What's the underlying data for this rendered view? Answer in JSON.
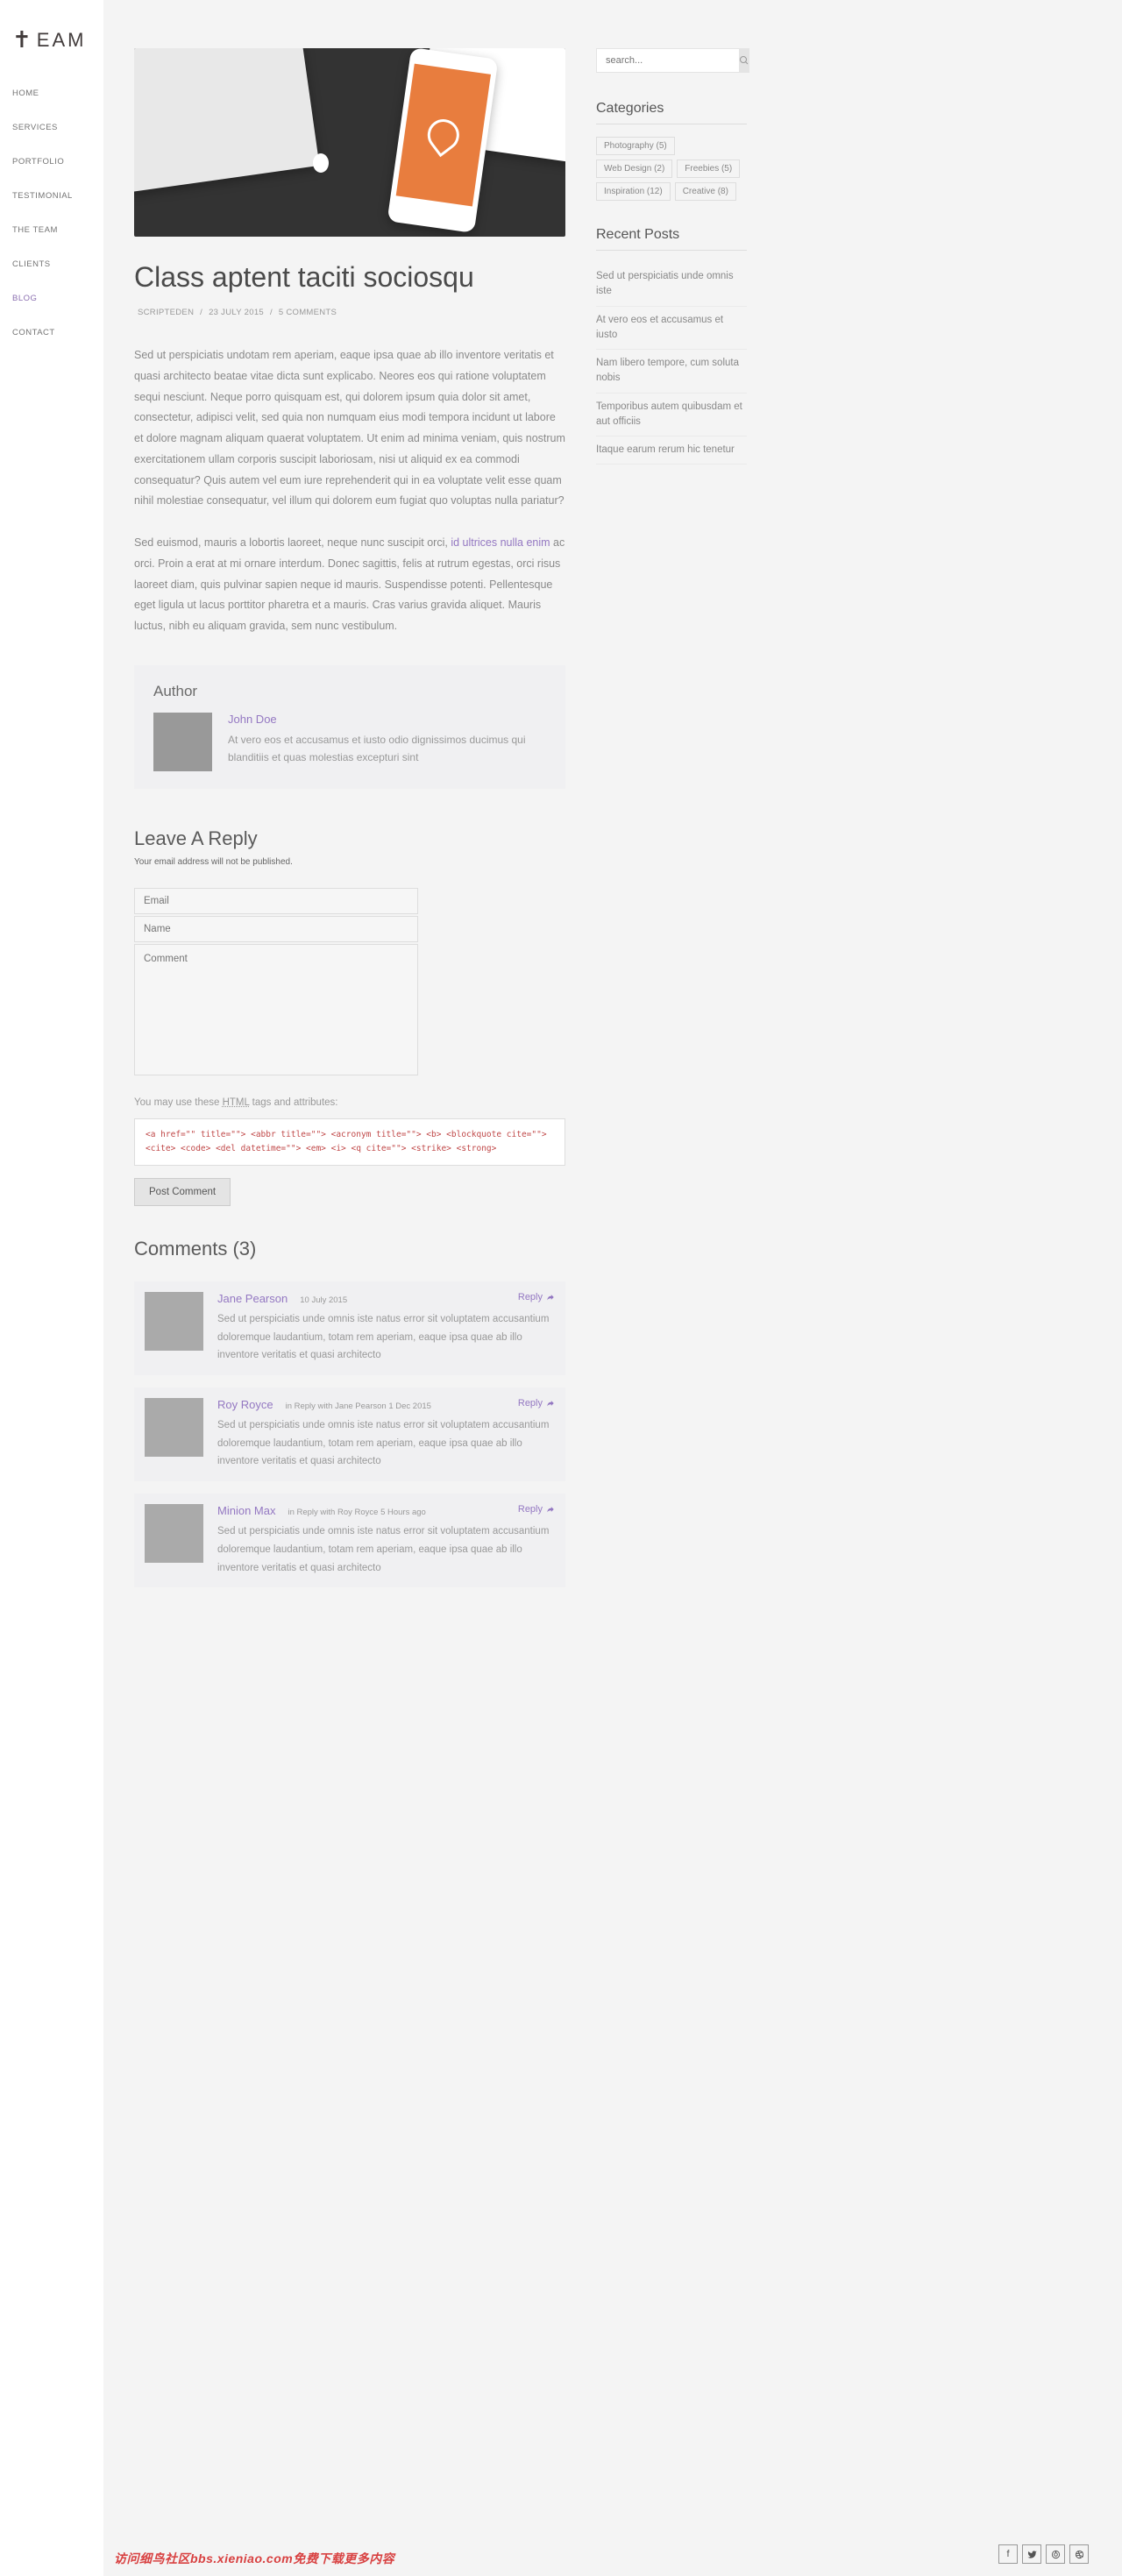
{
  "logo_text": "EAM",
  "nav": [
    "HOME",
    "SERVICES",
    "PORTFOLIO",
    "TESTIMONIAL",
    "THE TEAM",
    "CLIENTS",
    "BLOG",
    "CONTACT"
  ],
  "nav_active": 6,
  "post": {
    "title": "Class aptent taciti sociosqu",
    "meta_author": "SCRIPTEDEN",
    "meta_date": "23 JULY 2015",
    "meta_comments": "5 COMMENTS",
    "p1": "Sed ut perspiciatis undotam rem aperiam, eaque ipsa quae ab illo inventore veritatis et quasi architecto beatae vitae dicta sunt explicabo. Neores eos qui ratione voluptatem sequi nesciunt. Neque porro quisquam est, qui dolorem ipsum quia dolor sit amet, consectetur, adipisci velit, sed quia non numquam eius modi tempora incidunt ut labore et dolore magnam aliquam quaerat voluptatem. Ut enim ad minima veniam, quis nostrum exercitationem ullam corporis suscipit laboriosam, nisi ut aliquid ex ea commodi consequatur? Quis autem vel eum iure reprehenderit qui in ea voluptate velit esse quam nihil molestiae consequatur, vel illum qui dolorem eum fugiat quo voluptas nulla pariatur?",
    "p2a": "Sed euismod, mauris a lobortis laoreet, neque nunc suscipit orci, ",
    "p2_link": "id ultrices nulla enim",
    "p2b": " ac orci. Proin a erat at mi ornare interdum. Donec sagittis, felis at rutrum egestas, orci risus laoreet diam, quis pulvinar sapien neque id mauris. Suspendisse potenti. Pellentesque eget ligula ut lacus porttitor pharetra et a mauris. Cras varius gravida aliquet. Mauris luctus, nibh eu aliquam gravida, sem nunc vestibulum."
  },
  "author": {
    "heading": "Author",
    "name": "John Doe",
    "bio": "At vero eos et accusamus et iusto odio dignissimos ducimus qui blanditiis et quas molestias excepturi sint"
  },
  "reply": {
    "heading": "Leave A Reply",
    "note": "Your email address will not be published.",
    "email_ph": "Email",
    "name_ph": "Name",
    "comment_ph": "Comment",
    "hint_a": "You may use these ",
    "hint_abbr": "HTML",
    "hint_b": " tags and attributes:",
    "code": "<a href=\"\" title=\"\"> <abbr title=\"\"> <acronym title=\"\"> <b> <blockquote cite=\"\"> <cite> <code> <del datetime=\"\"> <em> <i> <q cite=\"\"> <strike> <strong>",
    "submit": "Post Comment"
  },
  "comments": {
    "heading": "Comments (3)",
    "items": [
      {
        "author": "Jane Pearson",
        "meta": "10 July 2015",
        "text": "Sed ut perspiciatis unde omnis iste natus error sit voluptatem accusantium doloremque laudantium, totam rem aperiam, eaque ipsa quae ab illo inventore veritatis et quasi architecto",
        "reply": "Reply"
      },
      {
        "author": "Roy Royce",
        "meta": "in Reply with Jane Pearson     1 Dec 2015",
        "text": "Sed ut perspiciatis unde omnis iste natus error sit voluptatem accusantium doloremque laudantium, totam rem aperiam, eaque ipsa quae ab illo inventore veritatis et quasi architecto",
        "reply": "Reply"
      },
      {
        "author": "Minion Max",
        "meta": "in Reply with Roy Royce     5 Hours ago",
        "text": "Sed ut perspiciatis unde omnis iste natus error sit voluptatem accusantium doloremque laudantium, totam rem aperiam, eaque ipsa quae ab illo inventore veritatis et quasi architecto",
        "reply": "Reply"
      }
    ]
  },
  "sidebar": {
    "search_ph": "search...",
    "cat_heading": "Categories",
    "tags": [
      "Photography (5)",
      "Web Design (2)",
      "Freebies (5)",
      "Inspiration (12)",
      "Creative (8)"
    ],
    "recent_heading": "Recent Posts",
    "recent": [
      "Sed ut perspiciatis unde omnis iste",
      "At vero eos et accusamus et iusto",
      "Nam libero tempore, cum soluta nobis",
      "Temporibus autem quibusdam et aut officiis",
      "Itaque earum rerum hic tenetur"
    ]
  },
  "watermark": "访问细鸟社区bbs.xieniao.com免费下载更多内容"
}
